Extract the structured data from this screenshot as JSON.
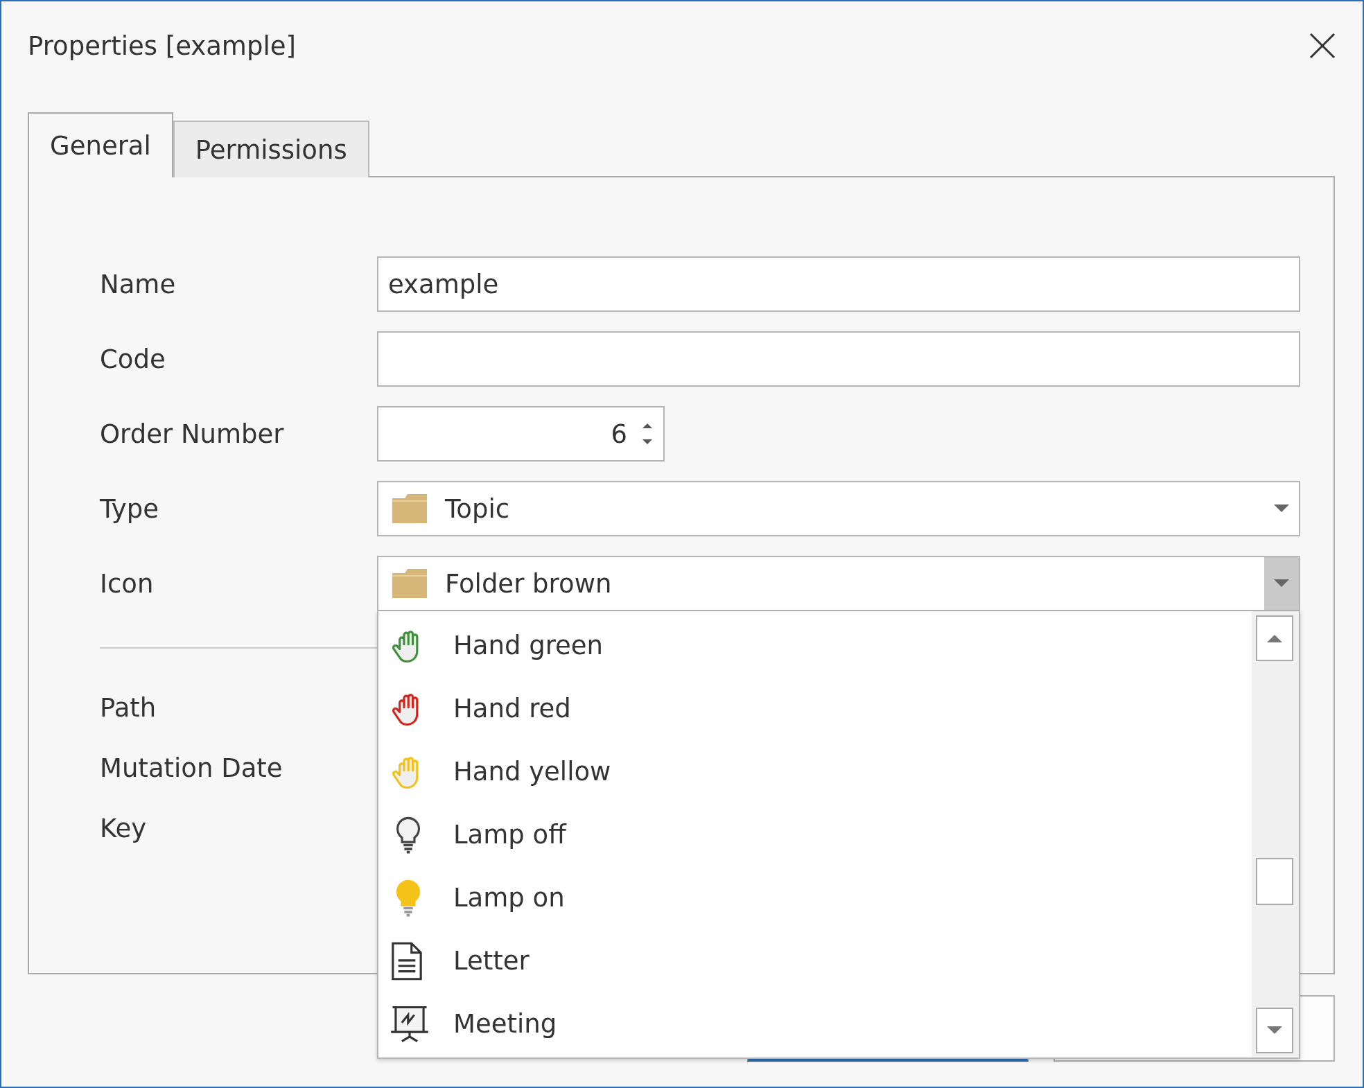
{
  "window": {
    "title": "Properties [example]"
  },
  "tabs": [
    {
      "label": "General",
      "selected": true
    },
    {
      "label": "Permissions",
      "selected": false
    }
  ],
  "fields": [
    {
      "label": "Name",
      "kind": "text",
      "value": "example"
    },
    {
      "label": "Code",
      "kind": "text"
    },
    {
      "label": "Order Number",
      "kind": "spin",
      "value": "6"
    },
    {
      "label": "Type",
      "kind": "combo",
      "value": "Topic",
      "expanded": false
    },
    {
      "label": "Icon",
      "kind": "combo",
      "value": "Folder brown",
      "expanded": true
    }
  ],
  "details": [
    {
      "label": "Path"
    },
    {
      "label": "Mutation Date"
    },
    {
      "label": "Key"
    }
  ],
  "icon_list": [
    {
      "label": "Hand green",
      "kind": "hand",
      "color": "#3f8f3a"
    },
    {
      "label": "Hand red",
      "kind": "hand",
      "color": "#d1261c"
    },
    {
      "label": "Hand yellow",
      "kind": "hand",
      "color": "#f2c21b"
    },
    {
      "label": "Lamp off",
      "kind": "lamp_off"
    },
    {
      "label": "Lamp on",
      "kind": "lamp_on"
    },
    {
      "label": "Letter",
      "kind": "letter"
    },
    {
      "label": "Meeting",
      "kind": "meeting"
    }
  ],
  "buttons": [
    {
      "focused": true
    },
    {
      "focused": false
    }
  ]
}
